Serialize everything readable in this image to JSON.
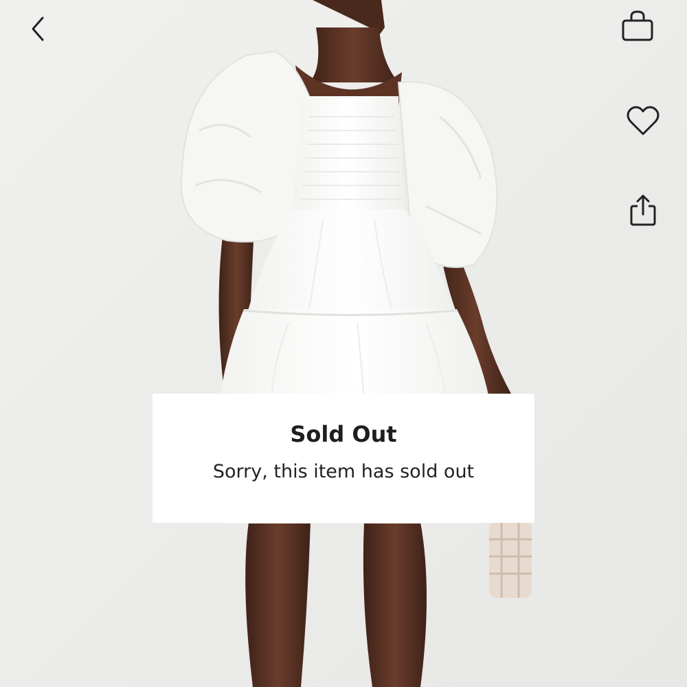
{
  "header": {
    "back_icon": "chevron-left-icon",
    "bag_icon": "shopping-bag-icon"
  },
  "side_actions": {
    "wishlist_icon": "heart-icon",
    "share_icon": "share-icon"
  },
  "dialog": {
    "title": "Sold Out",
    "message": "Sorry, this item has sold out"
  },
  "colors": {
    "background": "#ededeb",
    "dress": "#fafaf8",
    "skin": "#5a3425",
    "dialog_background": "#ffffff",
    "icon": "#222222"
  }
}
